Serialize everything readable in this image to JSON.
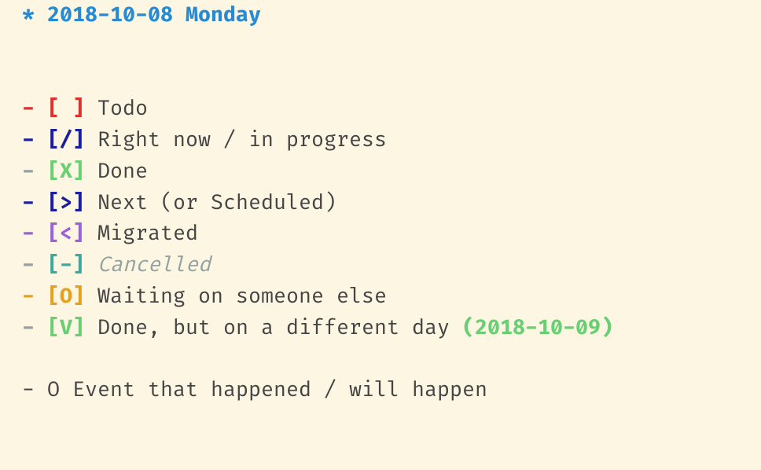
{
  "heading": {
    "bullet": "*",
    "text": "2018-10-08 Monday"
  },
  "items": [
    {
      "dash_color": "red",
      "marker": "[ ]",
      "marker_color": "red",
      "label": "Todo"
    },
    {
      "dash_color": "navy",
      "marker": "[/]",
      "marker_color": "navy",
      "label": "Right now / in progress"
    },
    {
      "dash_color": "gray",
      "marker": "[X]",
      "marker_color": "green",
      "label": "Done"
    },
    {
      "dash_color": "navy",
      "marker": "[>]",
      "marker_color": "navy",
      "label": "Next (or Scheduled)"
    },
    {
      "dash_color": "purple",
      "marker": "[<]",
      "marker_color": "purple",
      "label": "Migrated"
    },
    {
      "dash_color": "gray",
      "marker": "[-]",
      "marker_color": "teal",
      "label": "Cancelled",
      "label_italic_gray": true
    },
    {
      "dash_color": "orange",
      "marker": "[O]",
      "marker_color": "orange",
      "label": "Waiting on someone else"
    },
    {
      "dash_color": "gray",
      "marker": "[V]",
      "marker_color": "green",
      "label": "Done, but on a different day ",
      "trailing_date": "(2018-10-09)"
    }
  ],
  "event": {
    "dash": "-",
    "mark": "O",
    "label": "Event that happened / will happen"
  }
}
